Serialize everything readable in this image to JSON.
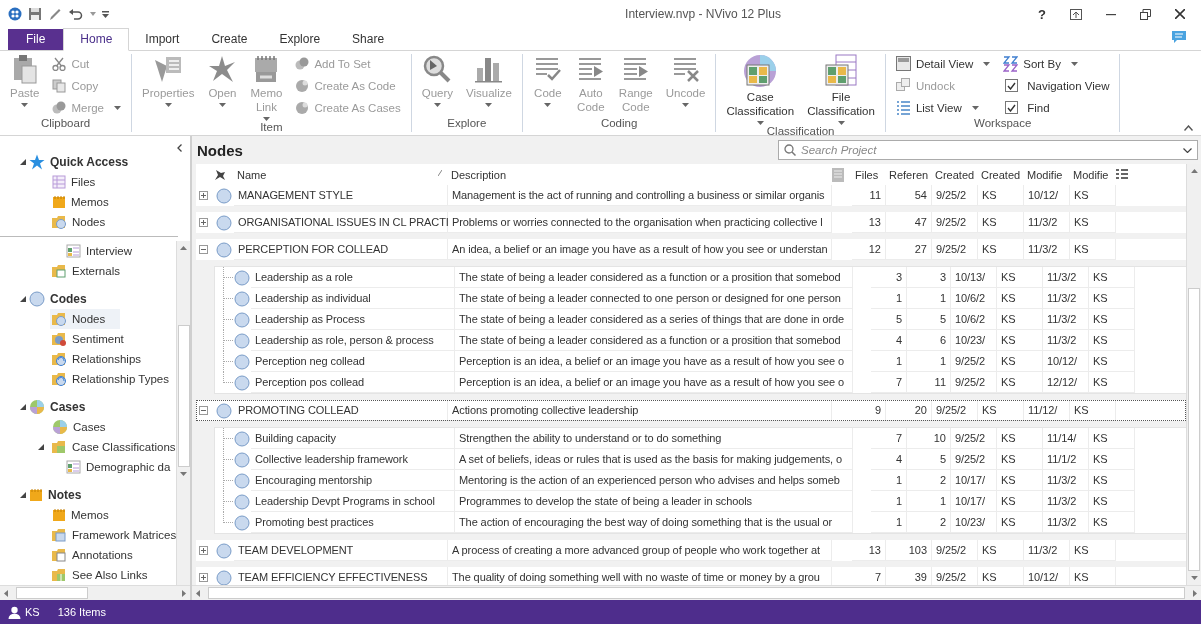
{
  "window": {
    "title": "Interview.nvp - NVivo 12 Plus",
    "help": "?"
  },
  "ribbon_tabs": [
    {
      "label": "File",
      "kind": "file",
      "selected": false
    },
    {
      "label": "Home",
      "kind": "tab",
      "selected": true
    },
    {
      "label": "Import",
      "kind": "tab",
      "selected": false
    },
    {
      "label": "Create",
      "kind": "tab",
      "selected": false
    },
    {
      "label": "Explore",
      "kind": "tab",
      "selected": false
    },
    {
      "label": "Share",
      "kind": "tab",
      "selected": false
    }
  ],
  "ribbon_groups": [
    {
      "label": "Clipboard",
      "items": [
        {
          "kind": "large",
          "label": "Paste",
          "dropdown": true,
          "disabled": true
        },
        {
          "kind": "stack",
          "items": [
            {
              "kind": "small",
              "label": "Cut",
              "dropdown": false,
              "disabled": true
            },
            {
              "kind": "small",
              "label": "Copy",
              "dropdown": false,
              "disabled": true
            },
            {
              "kind": "small",
              "label": "Merge",
              "dropdown": true,
              "disabled": true
            }
          ]
        }
      ]
    },
    {
      "label": "Item",
      "items": [
        {
          "kind": "large",
          "label": "Properties",
          "dropdown": true,
          "disabled": true
        },
        {
          "kind": "large",
          "label": "Open",
          "dropdown": true,
          "disabled": true
        },
        {
          "kind": "large",
          "label": "Memo Link",
          "dropdown": true,
          "disabled": true
        },
        {
          "kind": "stack",
          "items": [
            {
              "kind": "small",
              "label": "Add To Set",
              "dropdown": false,
              "disabled": true
            },
            {
              "kind": "small",
              "label": "Create As Code",
              "dropdown": false,
              "disabled": true
            },
            {
              "kind": "small",
              "label": "Create As Cases",
              "dropdown": false,
              "disabled": true
            }
          ]
        }
      ]
    },
    {
      "label": "Explore",
      "items": [
        {
          "kind": "large",
          "label": "Query",
          "dropdown": true,
          "disabled": true
        },
        {
          "kind": "large",
          "label": "Visualize",
          "dropdown": true,
          "disabled": true
        }
      ]
    },
    {
      "label": "Coding",
      "items": [
        {
          "kind": "large",
          "label": "Code",
          "dropdown": true,
          "disabled": true
        },
        {
          "kind": "large",
          "label": "Auto Code",
          "dropdown": false,
          "disabled": true
        },
        {
          "kind": "large",
          "label": "Range Code",
          "dropdown": false,
          "disabled": true
        },
        {
          "kind": "large",
          "label": "Uncode",
          "dropdown": true,
          "disabled": true
        }
      ]
    },
    {
      "label": "Classification",
      "items": [
        {
          "kind": "large",
          "label": "Case Classification",
          "dropdown": true,
          "disabled": false
        },
        {
          "kind": "large",
          "label": "File Classification",
          "dropdown": true,
          "disabled": false
        }
      ]
    },
    {
      "label": "Workspace",
      "items": [
        {
          "kind": "stack",
          "items": [
            {
              "kind": "small",
              "label": "Detail View",
              "dropdown": true,
              "disabled": false
            },
            {
              "kind": "small",
              "label": "Undock",
              "dropdown": false,
              "disabled": true
            },
            {
              "kind": "small",
              "label": "List View",
              "dropdown": true,
              "disabled": false
            }
          ]
        },
        {
          "kind": "stack",
          "items": [
            {
              "kind": "small",
              "label": "Sort By",
              "dropdown": true,
              "disabled": false
            },
            {
              "kind": "check",
              "label": "Navigation View",
              "checked": true
            },
            {
              "kind": "check",
              "label": "Find",
              "checked": true
            }
          ]
        }
      ]
    }
  ],
  "quick_access": {
    "label": "Quick Access",
    "expanded": true,
    "items": [
      {
        "label": "Files",
        "kind": "files",
        "selected": false
      },
      {
        "label": "Memos",
        "kind": "memos",
        "selected": false
      },
      {
        "label": "Nodes",
        "kind": "nodes",
        "selected": false
      }
    ]
  },
  "navigation": [
    {
      "items": [
        {
          "children": [
            {
              "label": "Interview",
              "kind": "table",
              "selected": false
            }
          ]
        },
        {
          "label": "Externals",
          "kind": "externals",
          "selected": false
        }
      ]
    },
    {
      "label": "Codes",
      "kind": "codes",
      "expanded": true,
      "items": [
        {
          "label": "Nodes",
          "kind": "nodes",
          "selected": true
        },
        {
          "label": "Sentiment",
          "kind": "sentiment",
          "selected": false
        },
        {
          "label": "Relationships",
          "kind": "relationships",
          "selected": false
        },
        {
          "label": "Relationship Types",
          "kind": "relationships",
          "selected": false
        }
      ]
    },
    {
      "label": "Cases",
      "kind": "cases",
      "expanded": true,
      "items": [
        {
          "label": "Cases",
          "kind": "cases",
          "selected": false
        },
        {
          "label": "Case Classifications",
          "kind": "classification",
          "selected": false,
          "expanded": true,
          "children": [
            {
              "label": "Demographic da",
              "kind": "table",
              "selected": false
            }
          ]
        }
      ]
    },
    {
      "label": "Notes",
      "kind": "notes",
      "expanded": true,
      "items": [
        {
          "label": "Memos",
          "kind": "memos",
          "selected": false
        },
        {
          "label": "Framework Matrices",
          "kind": "framework",
          "selected": false
        },
        {
          "label": "Annotations",
          "kind": "annotations",
          "selected": false
        },
        {
          "label": "See Also Links",
          "kind": "links",
          "selected": false
        }
      ]
    }
  ],
  "content": {
    "title": "Nodes",
    "search": {
      "placeholder": "Search Project"
    },
    "table": {
      "columns": [
        "Name",
        "Description",
        "Files",
        "Referen",
        "Created",
        "Created",
        "Modifie",
        "Modifie"
      ],
      "rows": [
        {
          "cells": [
            "MANAGEMENT STYLE",
            "Management is the act of running and controlling a business or similar organis",
            "11",
            "54",
            "9/25/2",
            "KS",
            "10/12/",
            "KS"
          ],
          "expanded": false,
          "focused": false
        },
        {
          "cells": [
            "ORGANISATIONAL ISSUES IN CL PRACTI",
            "Problems or worries connected to the organisation when practicing collective l",
            "13",
            "47",
            "9/25/2",
            "KS",
            "11/3/2",
            "KS"
          ],
          "expanded": false,
          "focused": false
        },
        {
          "cells": [
            "PERCEPTION FOR COLLEAD",
            "An idea, a belief or an image you have as a result of how you see or understan",
            "12",
            "27",
            "9/25/2",
            "KS",
            "11/3/2",
            "KS"
          ],
          "expanded": true,
          "focused": false,
          "children": [
            {
              "cells": [
                "Leadership as a role",
                "The state of being a leader considered as a function or a prosition that somebod",
                "3",
                "3",
                "10/13/",
                "KS",
                "11/3/2",
                "KS"
              ]
            },
            {
              "cells": [
                "Leadership as individual",
                "The state of being a leader connected to one person or designed for one person",
                "1",
                "1",
                "10/6/2",
                "KS",
                "11/3/2",
                "KS"
              ]
            },
            {
              "cells": [
                "Leadership as Process",
                "The state of being a leader considered as a series of things that are done in orde",
                "5",
                "5",
                "10/6/2",
                "KS",
                "11/3/2",
                "KS"
              ]
            },
            {
              "cells": [
                "Leadership as role, person & process",
                "The state of being a leader considered as a function or a prosition that somebod",
                "4",
                "6",
                "10/23/",
                "KS",
                "11/3/2",
                "KS"
              ]
            },
            {
              "cells": [
                "Perception neg collead",
                "Perception is an idea, a belief or an image you have as a result of how you see o",
                "1",
                "1",
                "9/25/2",
                "KS",
                "10/12/",
                "KS"
              ]
            },
            {
              "cells": [
                "Perception pos collead",
                "Perception is an idea, a belief or an image you have as a result of how you see o",
                "7",
                "11",
                "9/25/2",
                "KS",
                "12/12/",
                "KS"
              ]
            }
          ]
        },
        {
          "cells": [
            "PROMOTING COLLEAD",
            "Actions promoting collective leadership",
            "9",
            "20",
            "9/25/2",
            "KS",
            "11/12/",
            "KS"
          ],
          "expanded": true,
          "focused": true,
          "children": [
            {
              "cells": [
                "Building capacity",
                "Strengthen the ability to understand or to do something",
                "7",
                "10",
                "9/25/2",
                "KS",
                "11/14/",
                "KS"
              ]
            },
            {
              "cells": [
                "Collective leadership framework",
                "A set of beliefs, ideas or rules that is used as the basis for making judgements, o",
                "4",
                "5",
                "9/25/2",
                "KS",
                "11/1/2",
                "KS"
              ]
            },
            {
              "cells": [
                "Encouraging mentorship",
                "Mentoring is the action of an experienced person who advises and helps someb",
                "1",
                "2",
                "10/17/",
                "KS",
                "11/3/2",
                "KS"
              ]
            },
            {
              "cells": [
                "Leadership Devpt Programs in school",
                "Programmes to develop the state of being a leader in schools",
                "1",
                "1",
                "10/17/",
                "KS",
                "11/3/2",
                "KS"
              ]
            },
            {
              "cells": [
                "Promoting best practices",
                "The action of encouraging the best way of doing something that is the usual or",
                "1",
                "2",
                "10/23/",
                "KS",
                "11/3/2",
                "KS"
              ]
            }
          ]
        },
        {
          "cells": [
            "TEAM DEVELOPMENT",
            "A process of creating a more advanced group of people who work together at",
            "13",
            "103",
            "9/25/2",
            "KS",
            "11/3/2",
            "KS"
          ],
          "expanded": false,
          "focused": false
        },
        {
          "cells": [
            "TEAM EFFICIENCY EFFECTIVENESS",
            "The quality of doing something well with no waste of time or money by a grou",
            "7",
            "39",
            "9/25/2",
            "KS",
            "10/12/",
            "KS"
          ],
          "expanded": false,
          "focused": false
        }
      ]
    }
  },
  "status_bar": {
    "user": "KS",
    "items": "136 Items"
  }
}
